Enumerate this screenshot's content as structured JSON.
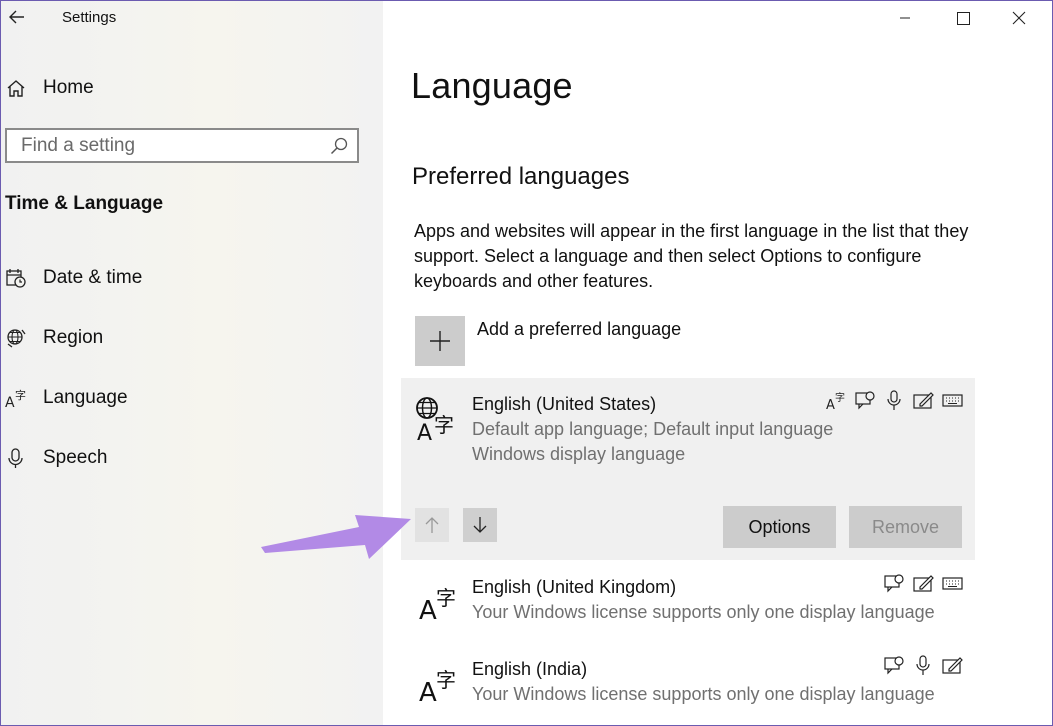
{
  "window": {
    "title": "Settings"
  },
  "sidebar": {
    "home_label": "Home",
    "search_placeholder": "Find a setting",
    "section_title": "Time & Language",
    "items": [
      {
        "label": "Date & time",
        "icon": "calendar-clock-icon"
      },
      {
        "label": "Region",
        "icon": "globe-icon"
      },
      {
        "label": "Language",
        "icon": "language-icon"
      },
      {
        "label": "Speech",
        "icon": "microphone-icon"
      }
    ]
  },
  "main": {
    "title": "Language",
    "section_title": "Preferred languages",
    "description": "Apps and websites will appear in the first language in the list that they support. Select a language and then select Options to configure keyboards and other features.",
    "add_label": "Add a preferred language",
    "languages": [
      {
        "name": "English (United States)",
        "sub1": "Default app language; Default input language",
        "sub2": "Windows display language",
        "features": [
          "display-language-icon",
          "text-to-speech-icon",
          "speech-recognition-icon",
          "handwriting-icon",
          "keyboard-icon"
        ]
      },
      {
        "name": "English (United Kingdom)",
        "sub1": "Your Windows license supports only one display language",
        "features": [
          "text-to-speech-icon",
          "handwriting-icon",
          "keyboard-icon"
        ]
      },
      {
        "name": "English (India)",
        "sub1": "Your Windows license supports only one display language",
        "features": [
          "text-to-speech-icon",
          "speech-recognition-icon",
          "handwriting-icon"
        ]
      }
    ],
    "options_label": "Options",
    "remove_label": "Remove"
  },
  "colors": {
    "annotation_arrow": "#b28ae6",
    "selected_row": "#f0f0f0",
    "button": "#cccccc"
  }
}
